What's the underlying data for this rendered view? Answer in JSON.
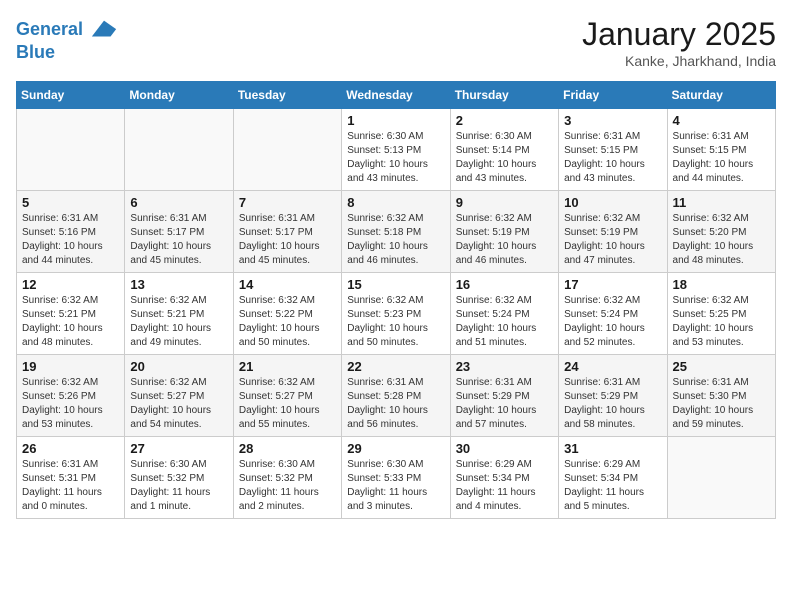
{
  "header": {
    "logo_line1": "General",
    "logo_line2": "Blue",
    "month_title": "January 2025",
    "location": "Kanke, Jharkhand, India"
  },
  "days_of_week": [
    "Sunday",
    "Monday",
    "Tuesday",
    "Wednesday",
    "Thursday",
    "Friday",
    "Saturday"
  ],
  "weeks": [
    [
      {
        "day": "",
        "info": ""
      },
      {
        "day": "",
        "info": ""
      },
      {
        "day": "",
        "info": ""
      },
      {
        "day": "1",
        "info": "Sunrise: 6:30 AM\nSunset: 5:13 PM\nDaylight: 10 hours\nand 43 minutes."
      },
      {
        "day": "2",
        "info": "Sunrise: 6:30 AM\nSunset: 5:14 PM\nDaylight: 10 hours\nand 43 minutes."
      },
      {
        "day": "3",
        "info": "Sunrise: 6:31 AM\nSunset: 5:15 PM\nDaylight: 10 hours\nand 43 minutes."
      },
      {
        "day": "4",
        "info": "Sunrise: 6:31 AM\nSunset: 5:15 PM\nDaylight: 10 hours\nand 44 minutes."
      }
    ],
    [
      {
        "day": "5",
        "info": "Sunrise: 6:31 AM\nSunset: 5:16 PM\nDaylight: 10 hours\nand 44 minutes."
      },
      {
        "day": "6",
        "info": "Sunrise: 6:31 AM\nSunset: 5:17 PM\nDaylight: 10 hours\nand 45 minutes."
      },
      {
        "day": "7",
        "info": "Sunrise: 6:31 AM\nSunset: 5:17 PM\nDaylight: 10 hours\nand 45 minutes."
      },
      {
        "day": "8",
        "info": "Sunrise: 6:32 AM\nSunset: 5:18 PM\nDaylight: 10 hours\nand 46 minutes."
      },
      {
        "day": "9",
        "info": "Sunrise: 6:32 AM\nSunset: 5:19 PM\nDaylight: 10 hours\nand 46 minutes."
      },
      {
        "day": "10",
        "info": "Sunrise: 6:32 AM\nSunset: 5:19 PM\nDaylight: 10 hours\nand 47 minutes."
      },
      {
        "day": "11",
        "info": "Sunrise: 6:32 AM\nSunset: 5:20 PM\nDaylight: 10 hours\nand 48 minutes."
      }
    ],
    [
      {
        "day": "12",
        "info": "Sunrise: 6:32 AM\nSunset: 5:21 PM\nDaylight: 10 hours\nand 48 minutes."
      },
      {
        "day": "13",
        "info": "Sunrise: 6:32 AM\nSunset: 5:21 PM\nDaylight: 10 hours\nand 49 minutes."
      },
      {
        "day": "14",
        "info": "Sunrise: 6:32 AM\nSunset: 5:22 PM\nDaylight: 10 hours\nand 50 minutes."
      },
      {
        "day": "15",
        "info": "Sunrise: 6:32 AM\nSunset: 5:23 PM\nDaylight: 10 hours\nand 50 minutes."
      },
      {
        "day": "16",
        "info": "Sunrise: 6:32 AM\nSunset: 5:24 PM\nDaylight: 10 hours\nand 51 minutes."
      },
      {
        "day": "17",
        "info": "Sunrise: 6:32 AM\nSunset: 5:24 PM\nDaylight: 10 hours\nand 52 minutes."
      },
      {
        "day": "18",
        "info": "Sunrise: 6:32 AM\nSunset: 5:25 PM\nDaylight: 10 hours\nand 53 minutes."
      }
    ],
    [
      {
        "day": "19",
        "info": "Sunrise: 6:32 AM\nSunset: 5:26 PM\nDaylight: 10 hours\nand 53 minutes."
      },
      {
        "day": "20",
        "info": "Sunrise: 6:32 AM\nSunset: 5:27 PM\nDaylight: 10 hours\nand 54 minutes."
      },
      {
        "day": "21",
        "info": "Sunrise: 6:32 AM\nSunset: 5:27 PM\nDaylight: 10 hours\nand 55 minutes."
      },
      {
        "day": "22",
        "info": "Sunrise: 6:31 AM\nSunset: 5:28 PM\nDaylight: 10 hours\nand 56 minutes."
      },
      {
        "day": "23",
        "info": "Sunrise: 6:31 AM\nSunset: 5:29 PM\nDaylight: 10 hours\nand 57 minutes."
      },
      {
        "day": "24",
        "info": "Sunrise: 6:31 AM\nSunset: 5:29 PM\nDaylight: 10 hours\nand 58 minutes."
      },
      {
        "day": "25",
        "info": "Sunrise: 6:31 AM\nSunset: 5:30 PM\nDaylight: 10 hours\nand 59 minutes."
      }
    ],
    [
      {
        "day": "26",
        "info": "Sunrise: 6:31 AM\nSunset: 5:31 PM\nDaylight: 11 hours\nand 0 minutes."
      },
      {
        "day": "27",
        "info": "Sunrise: 6:30 AM\nSunset: 5:32 PM\nDaylight: 11 hours\nand 1 minute."
      },
      {
        "day": "28",
        "info": "Sunrise: 6:30 AM\nSunset: 5:32 PM\nDaylight: 11 hours\nand 2 minutes."
      },
      {
        "day": "29",
        "info": "Sunrise: 6:30 AM\nSunset: 5:33 PM\nDaylight: 11 hours\nand 3 minutes."
      },
      {
        "day": "30",
        "info": "Sunrise: 6:29 AM\nSunset: 5:34 PM\nDaylight: 11 hours\nand 4 minutes."
      },
      {
        "day": "31",
        "info": "Sunrise: 6:29 AM\nSunset: 5:34 PM\nDaylight: 11 hours\nand 5 minutes."
      },
      {
        "day": "",
        "info": ""
      }
    ]
  ]
}
